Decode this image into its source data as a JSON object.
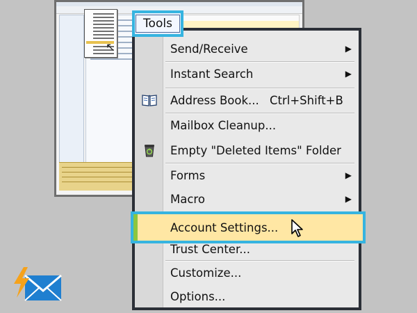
{
  "toolbar": {
    "menu_title": "Tools"
  },
  "menu": {
    "items": [
      {
        "label": "Send/Receive",
        "shortcut": "",
        "submenu": true
      },
      {
        "label": "Instant Search",
        "shortcut": "",
        "submenu": true
      },
      {
        "label": "Address Book...",
        "shortcut": "Ctrl+Shift+B",
        "submenu": false,
        "icon": "address-book-icon"
      },
      {
        "label": "Mailbox Cleanup...",
        "shortcut": "",
        "submenu": false
      },
      {
        "label": "Empty \"Deleted Items\" Folder",
        "shortcut": "",
        "submenu": false,
        "icon": "recycle-bin-icon"
      },
      {
        "label": "Forms",
        "shortcut": "",
        "submenu": true
      },
      {
        "label": "Macro",
        "shortcut": "",
        "submenu": true
      },
      {
        "label": "Account Settings...",
        "shortcut": "",
        "submenu": false,
        "highlighted": true
      },
      {
        "label": "Trust Center...",
        "shortcut": "",
        "submenu": false
      },
      {
        "label": "Customize...",
        "shortcut": "",
        "submenu": false
      },
      {
        "label": "Options...",
        "shortcut": "",
        "submenu": false
      }
    ]
  },
  "colors": {
    "highlight_border": "#36b4e0",
    "highlight_fill": "#ffe7a4",
    "highlight_accent": "#8cc63f",
    "menu_border": "#2b2f37"
  },
  "icons": [
    "address-book-icon",
    "recycle-bin-icon",
    "submenu-arrow-icon",
    "mouse-pointer-icon",
    "mail-logo-icon"
  ]
}
